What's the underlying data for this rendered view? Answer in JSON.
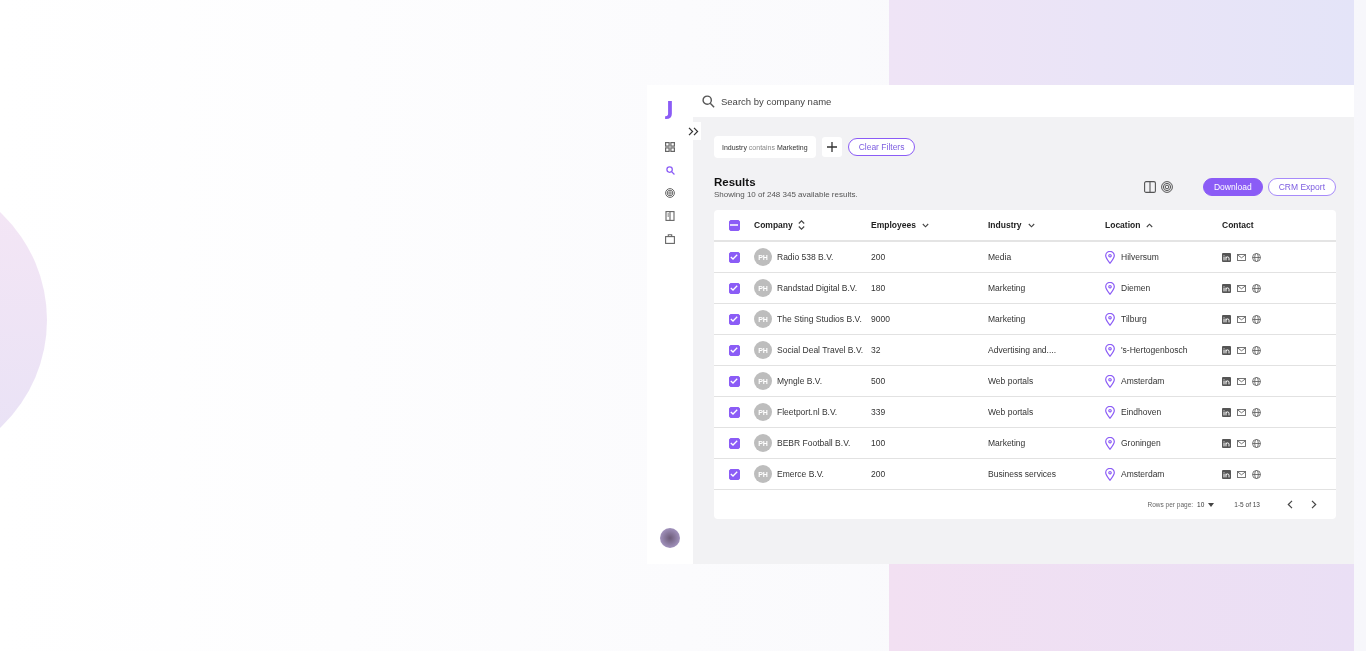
{
  "logo": "J",
  "sidebar": {
    "items": [
      {
        "selected": false
      },
      {
        "selected": true
      },
      {
        "selected": false
      },
      {
        "selected": false
      },
      {
        "selected": false
      }
    ]
  },
  "search": {
    "placeholder": "Search by company name"
  },
  "filters": [
    {
      "field": "Industry",
      "operator": "contains",
      "value": "Marketing"
    }
  ],
  "clear_filters": "Clear Filters",
  "results": {
    "title": "Results",
    "subtitle": "Showing 10 of 248 345 available results."
  },
  "buttons": [
    {
      "label": "Download",
      "kind": "primary"
    },
    {
      "label": "CRM Export",
      "kind": "outline"
    }
  ],
  "table": {
    "select_all": {
      "indeterminate": true
    },
    "columns": [
      {
        "label": "Company",
        "kind": "sortable"
      },
      {
        "label": "Employees",
        "kind": "descending"
      },
      {
        "label": "Industry",
        "kind": "descending"
      },
      {
        "label": "Location",
        "kind": "ascending"
      },
      {
        "label": "Contact",
        "kind": "plain"
      }
    ],
    "rows": [
      {
        "checked": true,
        "initials": "PH",
        "company": "Radio 538 B.V.",
        "employees": "200",
        "industry": "Media",
        "location": "Hilversum"
      },
      {
        "checked": true,
        "initials": "PH",
        "company": "Randstad Digital B.V.",
        "employees": "180",
        "industry": "Marketing",
        "location": "Diemen"
      },
      {
        "checked": true,
        "initials": "PH",
        "company": "The Sting Studios B.V.",
        "employees": "9000",
        "industry": "Marketing",
        "location": "Tilburg"
      },
      {
        "checked": true,
        "initials": "PH",
        "company": "Social Deal Travel B.V.",
        "employees": "32",
        "industry": "Advertising and....",
        "location": "'s-Hertogenbosch"
      },
      {
        "checked": true,
        "initials": "PH",
        "company": "Myngle B.V.",
        "employees": "500",
        "industry": "Web portals",
        "location": "Amsterdam"
      },
      {
        "checked": true,
        "initials": "PH",
        "company": "Fleetport.nl B.V.",
        "employees": "339",
        "industry": "Web portals",
        "location": "Eindhoven"
      },
      {
        "checked": true,
        "initials": "PH",
        "company": "BEBR Football B.V.",
        "employees": "100",
        "industry": "Marketing",
        "location": "Groningen"
      },
      {
        "checked": true,
        "initials": "PH",
        "company": "Emerce B.V.",
        "employees": "200",
        "industry": "Business services",
        "location": "Amsterdam"
      }
    ]
  },
  "pagination": {
    "rows_per_page_label": "Rows per page:",
    "rows_per_page": "10",
    "range": "1-5 of 13"
  }
}
